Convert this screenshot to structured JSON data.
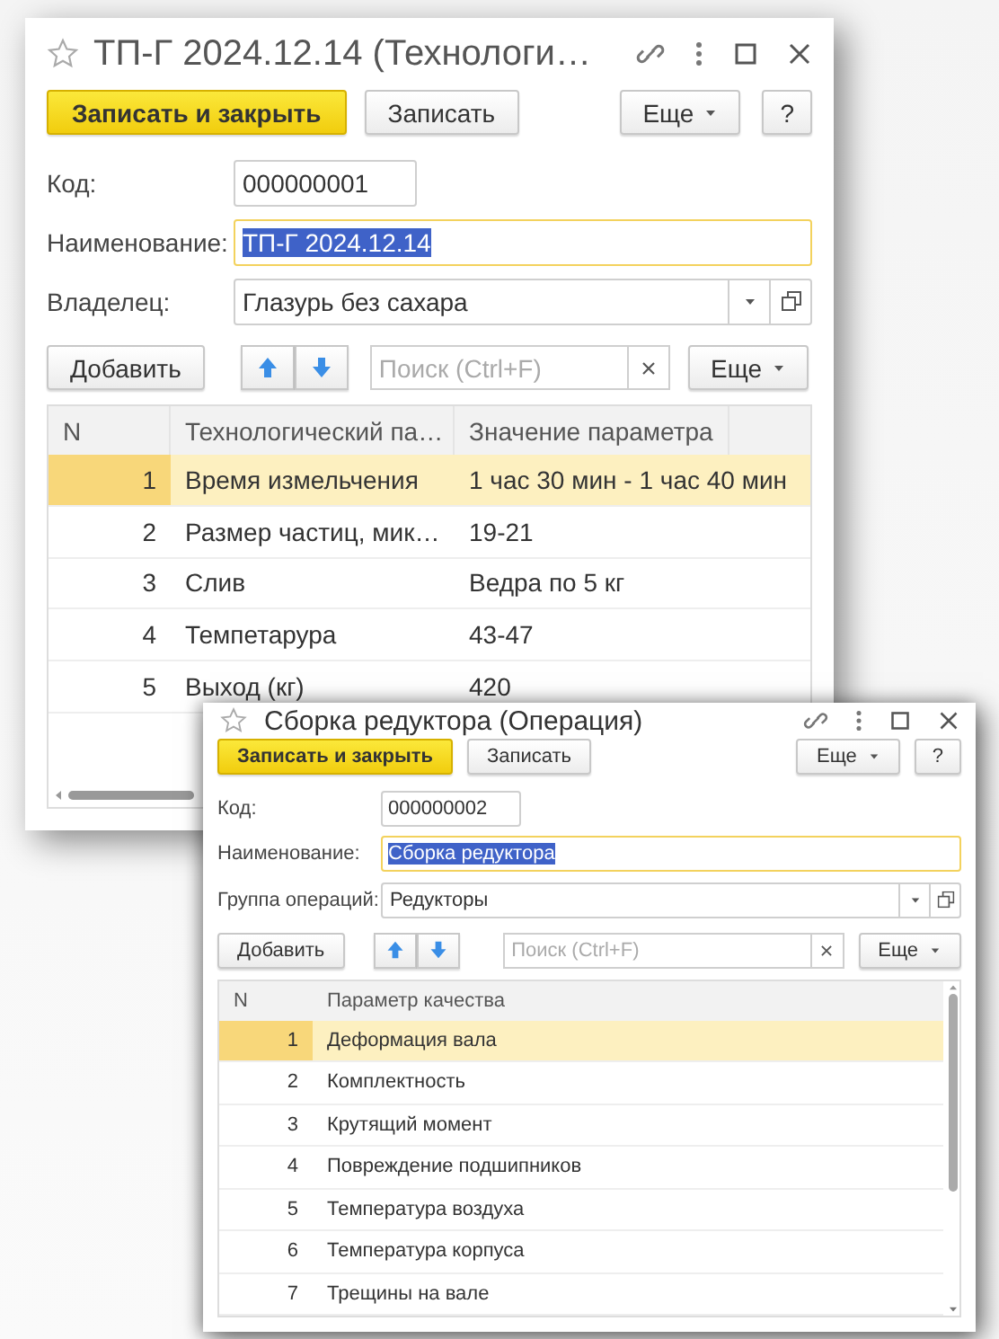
{
  "windows": [
    {
      "title": "ТП-Г 2024.12.14 (Технологи…",
      "command_bar": {
        "primary": "Записать и закрыть",
        "secondary": "Записать",
        "more": "Еще",
        "help": "?"
      },
      "fields": [
        {
          "kind": "code",
          "label": "Код:",
          "value": "000000001",
          "focused": false
        },
        {
          "kind": "name",
          "label": "Наименование:",
          "value": "ТП-Г 2024.12.14",
          "focused": true
        },
        {
          "kind": "select",
          "label": "Владелец:",
          "value": "Глазурь без сахара",
          "focused": false
        }
      ],
      "toolbar": {
        "add": "Добавить",
        "search_placeholder": "Поиск (Ctrl+F)",
        "more": "Еще"
      },
      "table": {
        "columns": [
          "N",
          "Технологический па…",
          "Значение параметра"
        ],
        "rows": [
          {
            "cells": [
              "1",
              "Время измельчения",
              "1 час 30 мин - 1 час 40 мин"
            ],
            "selected": true
          },
          {
            "cells": [
              "2",
              "Размер частиц, мик…",
              "19-21"
            ],
            "selected": false
          },
          {
            "cells": [
              "3",
              "Слив",
              "Ведра по 5 кг"
            ],
            "selected": false
          },
          {
            "cells": [
              "4",
              "Темпетарура",
              "43-47"
            ],
            "selected": false
          },
          {
            "cells": [
              "5",
              "Выход (кг)",
              "420"
            ],
            "selected": false
          }
        ]
      }
    },
    {
      "title": "Сборка редуктора (Операция)",
      "command_bar": {
        "primary": "Записать и закрыть",
        "secondary": "Записать",
        "more": "Еще",
        "help": "?"
      },
      "fields": [
        {
          "kind": "code",
          "label": "Код:",
          "value": "000000002",
          "focused": false
        },
        {
          "kind": "name",
          "label": "Наименование:",
          "value": "Сборка редуктора",
          "focused": true
        },
        {
          "kind": "select",
          "label": "Группа операций:",
          "value": "Редукторы",
          "focused": false
        }
      ],
      "toolbar": {
        "add": "Добавить",
        "search_placeholder": "Поиск (Ctrl+F)",
        "more": "Еще"
      },
      "table": {
        "columns": [
          "N",
          "Параметр качества"
        ],
        "rows": [
          {
            "cells": [
              "1",
              "Деформация вала"
            ],
            "selected": true
          },
          {
            "cells": [
              "2",
              "Комплектность"
            ],
            "selected": false
          },
          {
            "cells": [
              "3",
              "Крутящий момент"
            ],
            "selected": false
          },
          {
            "cells": [
              "4",
              "Повреждение подшипников"
            ],
            "selected": false
          },
          {
            "cells": [
              "5",
              "Температура воздуха"
            ],
            "selected": false
          },
          {
            "cells": [
              "6",
              "Температура корпуса"
            ],
            "selected": false
          },
          {
            "cells": [
              "7",
              "Трещины на вале"
            ],
            "selected": false
          }
        ]
      }
    }
  ]
}
